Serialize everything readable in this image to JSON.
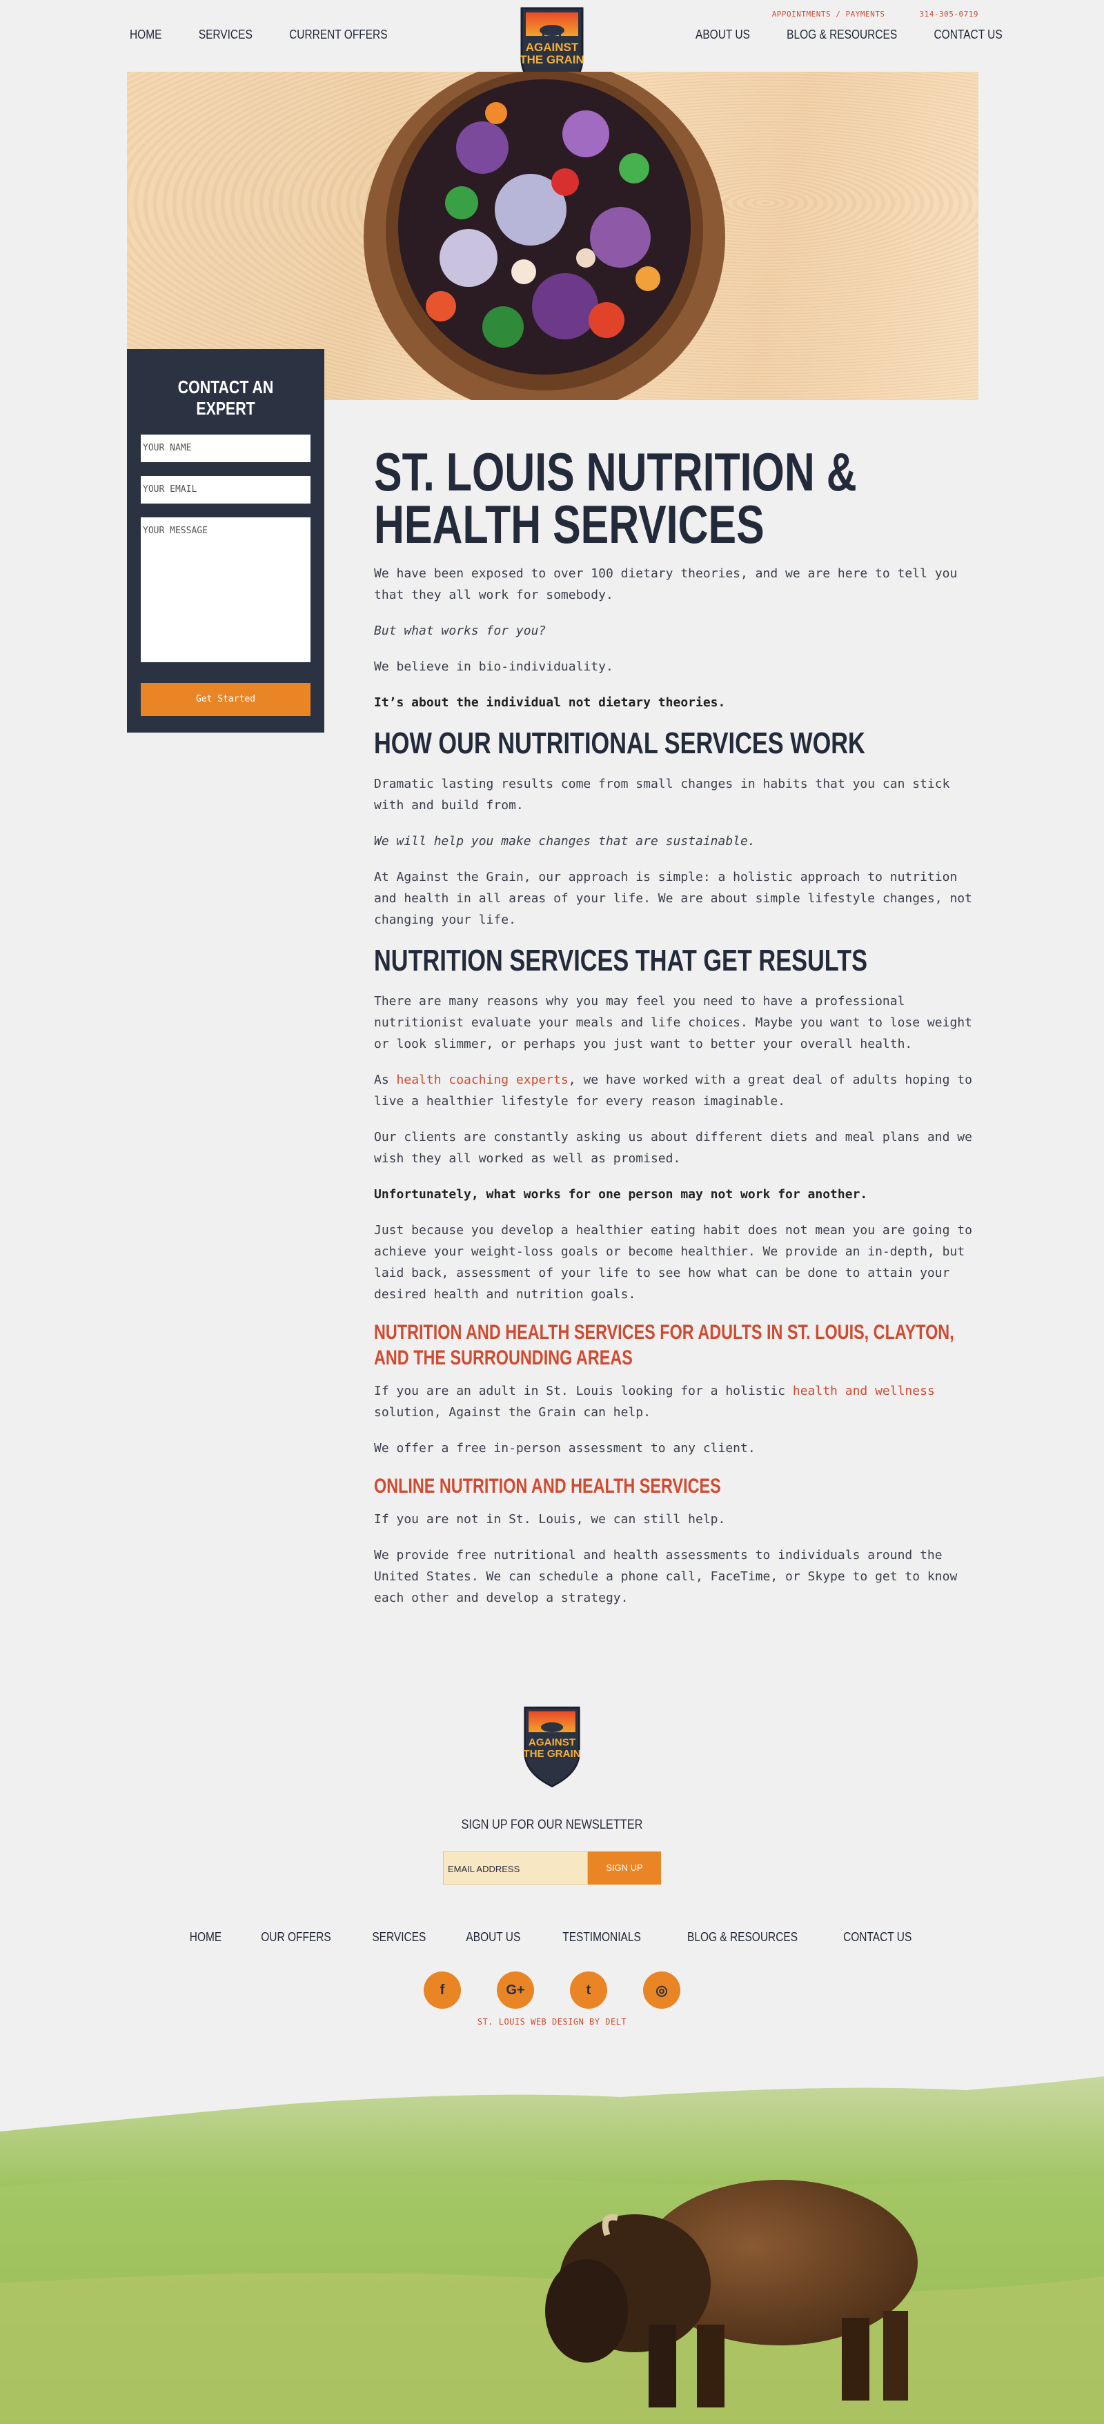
{
  "header": {
    "top_links": [
      "APPOINTMENTS / PAYMENTS",
      "314-305-0719"
    ],
    "nav_left": [
      "HOME",
      "SERVICES",
      "CURRENT OFFERS"
    ],
    "nav_right": [
      "ABOUT US",
      "BLOG & RESOURCES",
      "CONTACT US"
    ],
    "logo_text": [
      "AGAINST",
      "THE GRAIN"
    ]
  },
  "contact": {
    "title": "CONTACT AN EXPERT",
    "name_placeholder": "YOUR NAME",
    "email_placeholder": "YOUR EMAIL",
    "message_placeholder": "YOUR MESSAGE",
    "submit_label": "Get Started"
  },
  "main": {
    "title": "ST. LOUIS NUTRITION & HEALTH SERVICES",
    "intro": [
      "We have been exposed to over 100 dietary theories, and we are here to tell you that they all work for somebody.",
      "But what works for you?",
      "We believe in bio-individuality.",
      "It’s about the individual not dietary theories."
    ],
    "section1_title": "HOW OUR NUTRITIONAL SERVICES WORK",
    "section1": [
      "Dramatic lasting results come from small changes in habits that you can stick with and build from.",
      "We will help you make changes that are sustainable.",
      "At Against the Grain, our approach is simple: a holistic approach to nutrition and health in all areas of your life. We are about simple lifestyle changes, not changing your life."
    ],
    "section2_title": "NUTRITION SERVICES THAT GET RESULTS",
    "section2_p1": "There are many reasons why you may feel you need to have a professional nutritionist evaluate your meals and life choices. Maybe you want to lose weight or look slimmer, or perhaps you just want to better your overall health.",
    "section2_p2_pre": "As ",
    "section2_p2_link": "health coaching experts",
    "section2_p2_post": ", we have worked with a great deal of adults hoping to live a healthier lifestyle for every reason imaginable.",
    "section2_p3": "Our clients are constantly asking us about different diets and meal plans and we wish they all worked as well as promised.",
    "section2_p4": "Unfortunately, what works for one person may not work for another.",
    "section2_p5": "Just because you develop a healthier eating habit does not mean you are going to achieve your weight-loss goals or become healthier. We provide an in-depth, but laid back, assessment of your life to see how what can be done to attain your desired health and nutrition goals.",
    "section3_title": "NUTRITION AND HEALTH SERVICES FOR ADULTS IN ST. LOUIS, CLAYTON, AND THE SURROUNDING AREAS",
    "section3_p1_pre": "If you are an adult in St. Louis looking for a holistic ",
    "section3_p1_link": "health and wellness",
    "section3_p1_post": " solution, Against the Grain can help.",
    "section3_p2": "We offer a free in-person assessment to any client.",
    "section4_title": "ONLINE NUTRITION AND HEALTH SERVICES",
    "section4_p1": "If you are not in St. Louis, we can still help.",
    "section4_p2": "We provide free nutritional and health  assessments to individuals around the United States. We can schedule a phone call, FaceTime, or Skype to get to know each other and develop a strategy."
  },
  "footer": {
    "newsletter_title": "SIGN UP FOR OUR NEWSLETTER",
    "email_placeholder": "EMAIL ADDRESS",
    "signup_label": "SIGN UP",
    "nav": [
      "HOME",
      "OUR OFFERS",
      "SERVICES",
      "ABOUT US",
      "TESTIMONIALS",
      "BLOG & RESOURCES",
      "CONTACT US"
    ],
    "social_icons": [
      "facebook-icon",
      "google-plus-icon",
      "twitter-icon",
      "instagram-icon"
    ],
    "social_glyphs": [
      "f",
      "G+",
      "t",
      "◎"
    ],
    "credit": "ST. LOUIS WEB DESIGN BY DELT"
  },
  "colors": {
    "accent": "#ea8526",
    "link": "#d04a30",
    "navy": "#2b3242"
  }
}
